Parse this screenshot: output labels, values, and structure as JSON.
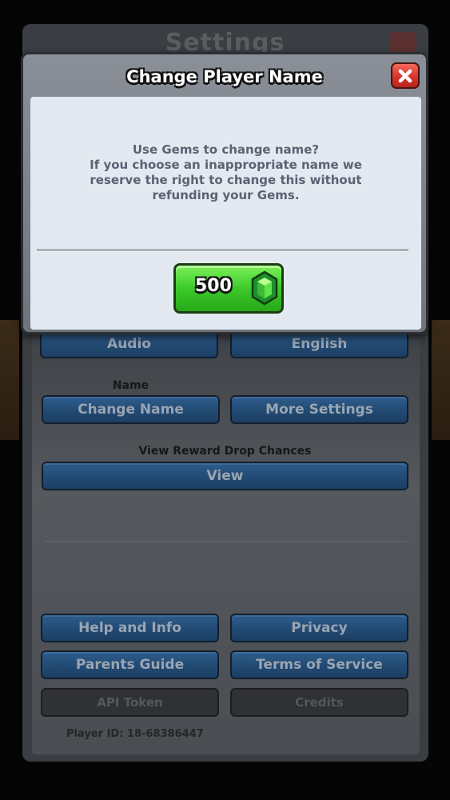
{
  "background": {
    "title": "Settings",
    "buttons": {
      "audio": "Audio",
      "language": "English",
      "change_name": "Change Name",
      "more_settings": "More Settings",
      "view": "View",
      "help": "Help and Info",
      "privacy": "Privacy",
      "parents_guide": "Parents Guide",
      "terms": "Terms of Service",
      "api_token": "API Token",
      "credits": "Credits"
    },
    "labels": {
      "name": "Name",
      "reward_drop": "View Reward Drop Chances"
    },
    "player_id": "Player ID: 18-68386447"
  },
  "modal": {
    "title": "Change Player Name",
    "close_icon": "close-x-icon",
    "message_lines": [
      "Use Gems to change name?",
      "If you choose an inappropriate name we",
      "reserve the right to change this without",
      "refunding your Gems."
    ],
    "price": "500",
    "currency_icon": "gem-icon"
  },
  "colors": {
    "confirm_green": "#3cc92a",
    "close_red": "#d5352b",
    "button_blue": "#224a73",
    "content_bg": "#e3e9f0"
  }
}
